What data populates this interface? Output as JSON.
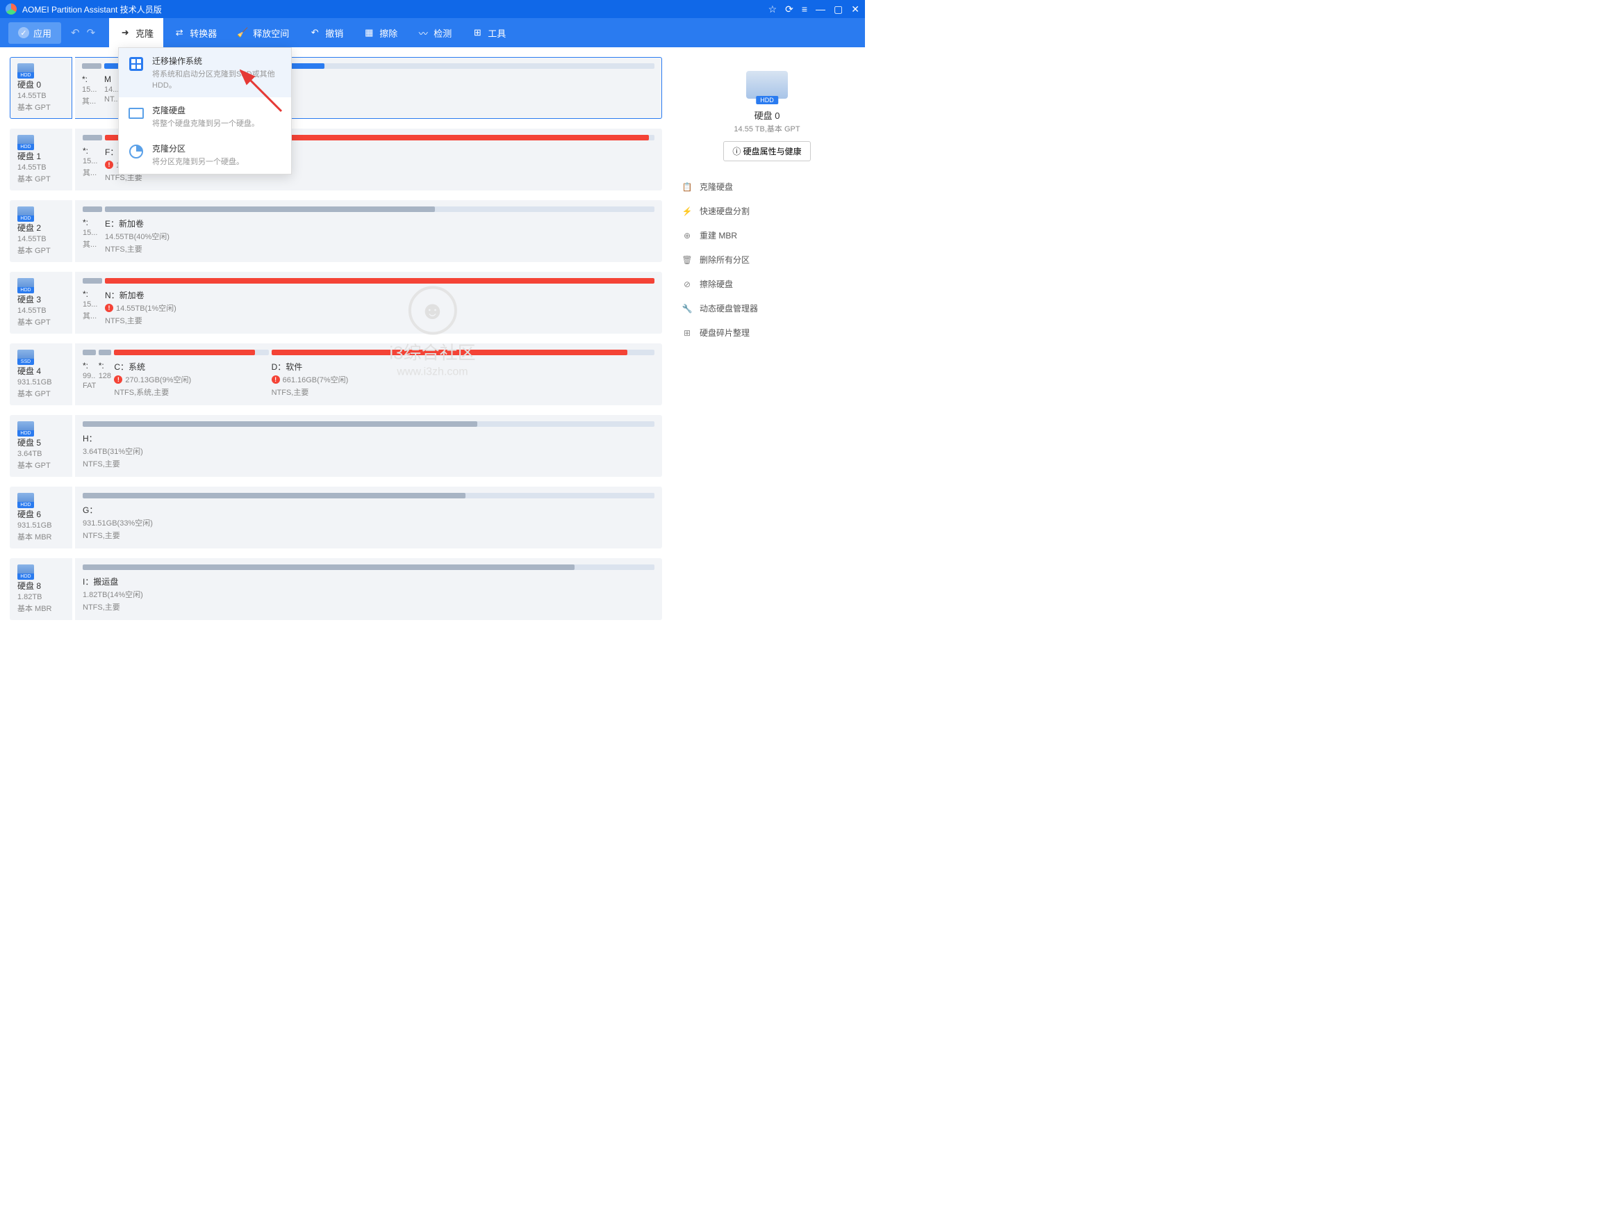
{
  "app_title": "AOMEI Partition Assistant 技术人员版",
  "toolbar": {
    "apply": "应用",
    "tabs": [
      {
        "label": "克隆",
        "icon": "clone"
      },
      {
        "label": "转换器",
        "icon": "convert"
      },
      {
        "label": "释放空间",
        "icon": "free"
      },
      {
        "label": "撤销",
        "icon": "undo"
      },
      {
        "label": "擦除",
        "icon": "wipe"
      },
      {
        "label": "检测",
        "icon": "check"
      },
      {
        "label": "工具",
        "icon": "tools"
      }
    ]
  },
  "dropdown": [
    {
      "title": "迁移操作系统",
      "desc": "将系统和启动分区克隆到SSD或其他HDD。"
    },
    {
      "title": "克隆硬盘",
      "desc": "将整个硬盘克隆到另一个硬盘。"
    },
    {
      "title": "克隆分区",
      "desc": "将分区克隆到另一个硬盘。"
    }
  ],
  "disks": [
    {
      "name": "硬盘 0",
      "size": "14.55TB",
      "type": "基本 GPT",
      "small_letter": "*:",
      "small_size": "15...",
      "small_fs": "其...",
      "parts": [
        {
          "label": "M",
          "size": "14...",
          "fs": "NT...",
          "fill": 40,
          "color": "blue"
        }
      ]
    },
    {
      "name": "硬盘 1",
      "size": "14.55TB",
      "type": "基本 GPT",
      "small_letter": "*:",
      "small_size": "15...",
      "small_fs": "其...",
      "parts": [
        {
          "label": "F：新加卷",
          "size": "14.55TB(1%空闲)",
          "fs": "NTFS,主要",
          "fill": 99,
          "color": "red",
          "warn": true
        }
      ]
    },
    {
      "name": "硬盘 2",
      "size": "14.55TB",
      "type": "基本 GPT",
      "small_letter": "*:",
      "small_size": "15...",
      "small_fs": "其...",
      "parts": [
        {
          "label": "E：新加卷",
          "size": "14.55TB(40%空闲)",
          "fs": "NTFS,主要",
          "fill": 60,
          "color": "gray"
        }
      ]
    },
    {
      "name": "硬盘 3",
      "size": "14.55TB",
      "type": "基本 GPT",
      "small_letter": "*:",
      "small_size": "15...",
      "small_fs": "其...",
      "parts": [
        {
          "label": "N：新加卷",
          "size": "14.55TB(1%空闲)",
          "fs": "NTFS,主要",
          "fill": 100,
          "color": "red",
          "warn": true
        }
      ]
    },
    {
      "name": "硬盘 4",
      "size": "931.51GB",
      "type": "基本 GPT",
      "ssd": true,
      "small_letter": "*:",
      "small_size": "99...",
      "small_fs": "FAT...",
      "small2_letter": "*:",
      "small2_size": "128...",
      "parts": [
        {
          "label": "C：系统",
          "size": "270.13GB(9%空闲)",
          "fs": "NTFS,系统,主要",
          "fill": 91,
          "color": "red",
          "warn": true,
          "width": 27
        },
        {
          "label": "D：软件",
          "size": "661.16GB(7%空闲)",
          "fs": "NTFS,主要",
          "fill": 93,
          "color": "red",
          "warn": true,
          "width": 67
        }
      ]
    },
    {
      "name": "硬盘 5",
      "size": "3.64TB",
      "type": "基本 GPT",
      "nosmall": true,
      "parts": [
        {
          "label": "H：",
          "size": "3.64TB(31%空闲)",
          "fs": "NTFS,主要",
          "fill": 69,
          "color": "gray"
        }
      ]
    },
    {
      "name": "硬盘 6",
      "size": "931.51GB",
      "type": "基本 MBR",
      "nosmall": true,
      "parts": [
        {
          "label": "G：",
          "size": "931.51GB(33%空闲)",
          "fs": "NTFS,主要",
          "fill": 67,
          "color": "gray"
        }
      ]
    },
    {
      "name": "硬盘 8",
      "size": "1.82TB",
      "type": "基本 MBR",
      "nosmall": true,
      "parts": [
        {
          "label": "I：搬运盘",
          "size": "1.82TB(14%空闲)",
          "fs": "NTFS,主要",
          "fill": 86,
          "color": "gray"
        }
      ]
    }
  ],
  "side": {
    "disk_name": "硬盘 0",
    "disk_info": "14.55 TB,基本 GPT",
    "health_btn": "硬盘属性与健康",
    "actions": [
      {
        "label": "克隆硬盘",
        "icon": "📋"
      },
      {
        "label": "快速硬盘分割",
        "icon": "⚡"
      },
      {
        "label": "重建 MBR",
        "icon": "⊕"
      },
      {
        "label": "删除所有分区",
        "icon": "🗑"
      },
      {
        "label": "擦除硬盘",
        "icon": "⊘"
      },
      {
        "label": "动态硬盘管理器",
        "icon": "🔧"
      },
      {
        "label": "硬盘碎片整理",
        "icon": "⊞"
      }
    ]
  },
  "watermark": {
    "text": "i3综合社区",
    "url": "www.i3zh.com"
  }
}
